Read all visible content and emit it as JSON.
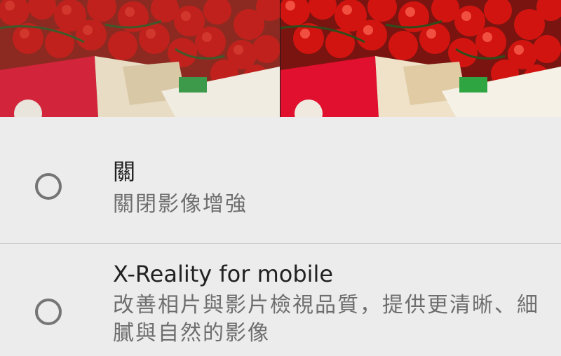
{
  "preview": {
    "left_label": "",
    "right_label": ""
  },
  "options": [
    {
      "title": "關",
      "description": "關閉影像增強",
      "selected": false
    },
    {
      "title": "X-Reality for mobile",
      "description": "改善相片與影片檢視品質，提供更清晰、細膩與自然的影像",
      "selected": false
    }
  ],
  "colors": {
    "background": "#ececec",
    "title": "#212121",
    "description": "#6e6e6e",
    "radio": "#757575",
    "divider": "#cfcfcf"
  }
}
